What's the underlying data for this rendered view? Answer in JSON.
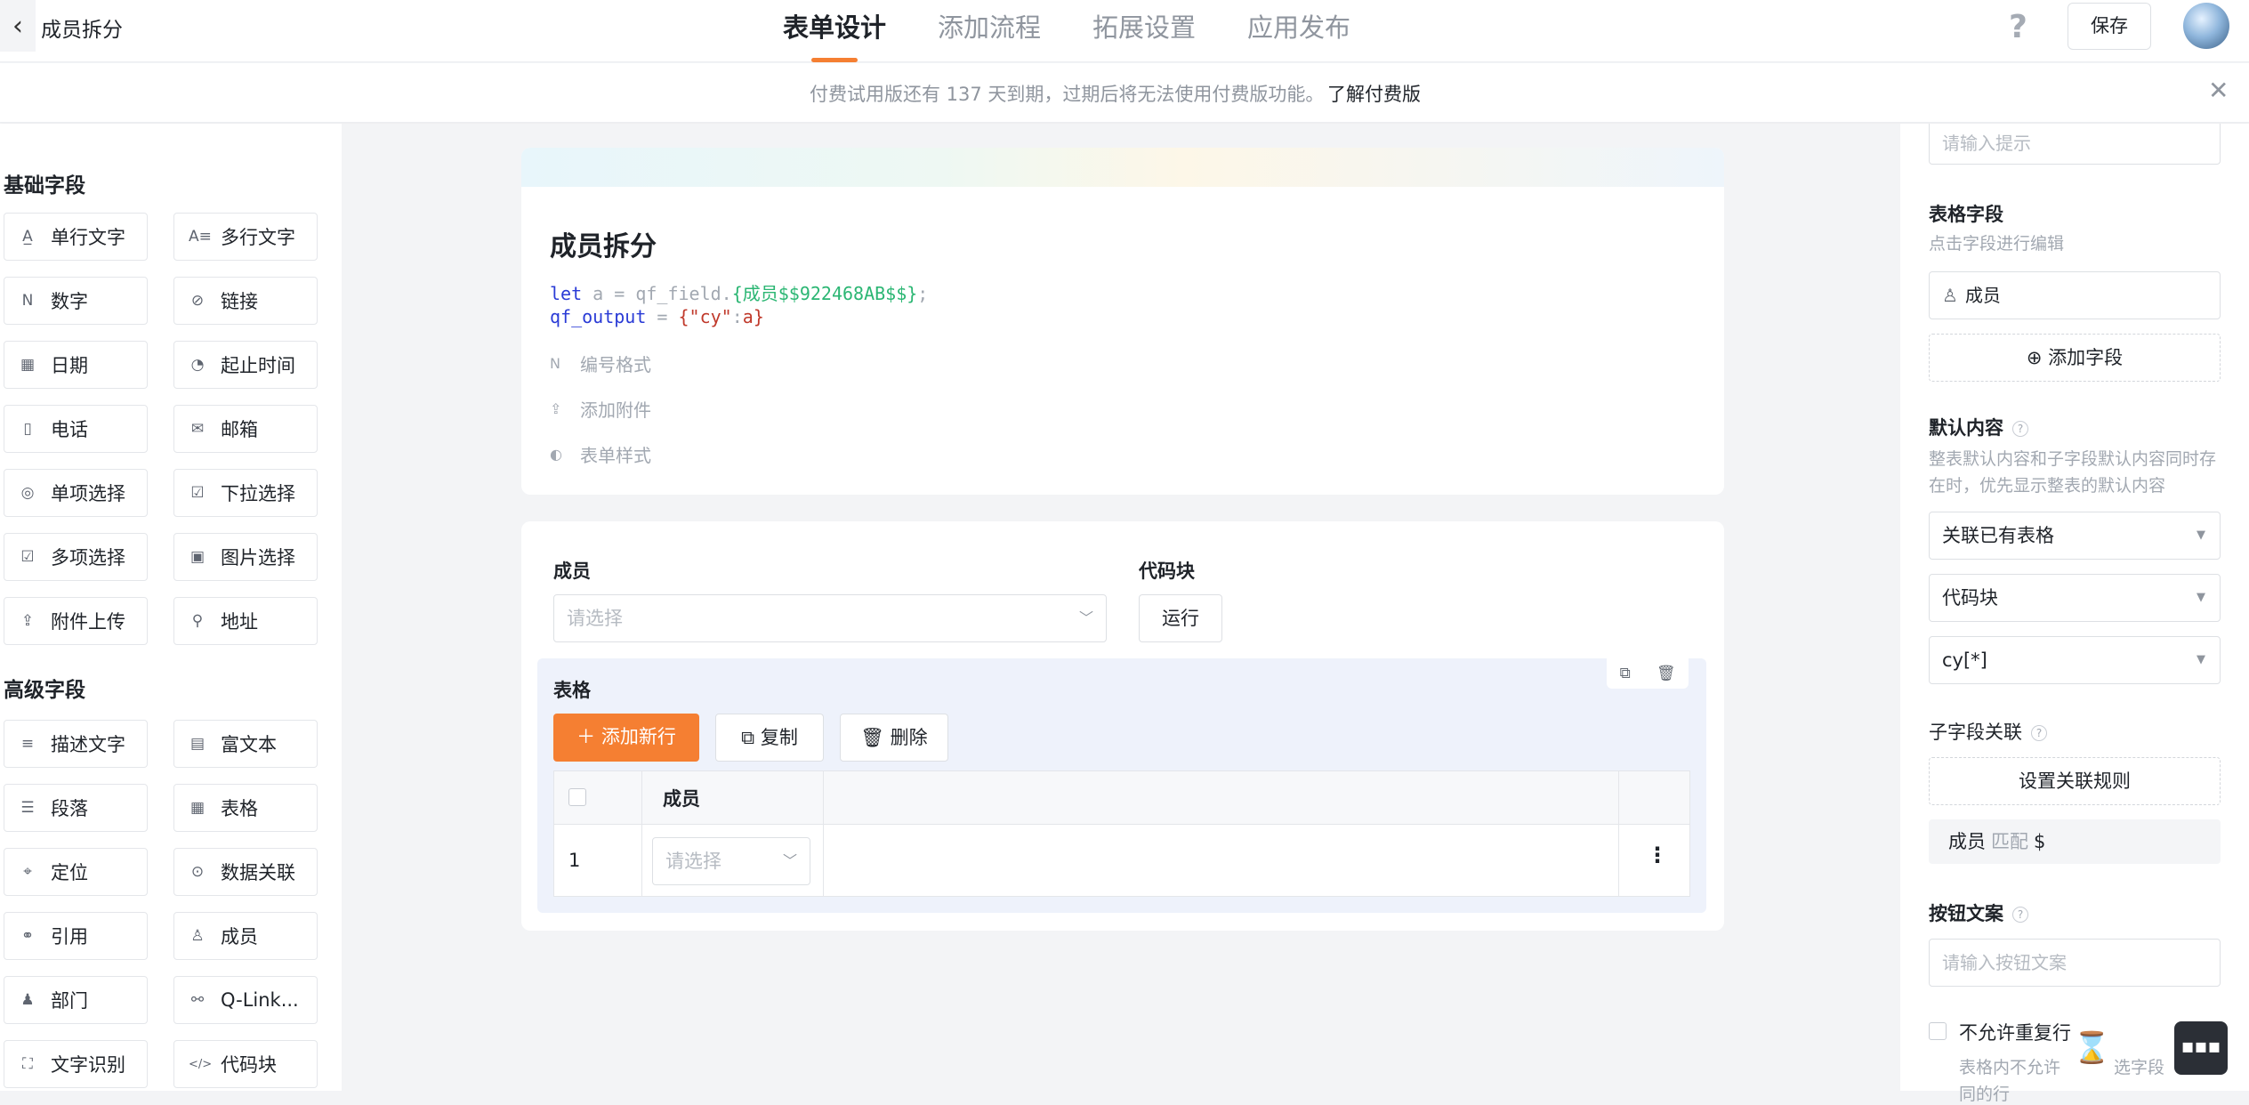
{
  "header": {
    "app_title": "成员拆分",
    "tabs": [
      "表单设计",
      "添加流程",
      "拓展设置",
      "应用发布"
    ],
    "help": "?",
    "save_label": "保存"
  },
  "banner": {
    "text": "付费试用版还有 137 天到期，过期后将无法使用付费版功能。",
    "link": "了解付费版"
  },
  "left": {
    "basic_title": "基础字段",
    "basic_fields": [
      {
        "label": "单行文字",
        "icon": "A̲"
      },
      {
        "label": "多行文字",
        "icon": "A≡"
      },
      {
        "label": "数字",
        "icon": "N"
      },
      {
        "label": "链接",
        "icon": "⊘"
      },
      {
        "label": "日期",
        "icon": "▦"
      },
      {
        "label": "起止时间",
        "icon": "◔"
      },
      {
        "label": "电话",
        "icon": "▯"
      },
      {
        "label": "邮箱",
        "icon": "✉"
      },
      {
        "label": "单项选择",
        "icon": "◎"
      },
      {
        "label": "下拉选择",
        "icon": "☑"
      },
      {
        "label": "多项选择",
        "icon": "☑"
      },
      {
        "label": "图片选择",
        "icon": "▣"
      },
      {
        "label": "附件上传",
        "icon": "⇪"
      },
      {
        "label": "地址",
        "icon": "⚲"
      }
    ],
    "advanced_title": "高级字段",
    "advanced_fields": [
      {
        "label": "描述文字",
        "icon": "≡"
      },
      {
        "label": "富文本",
        "icon": "▤"
      },
      {
        "label": "段落",
        "icon": "☰"
      },
      {
        "label": "表格",
        "icon": "▦"
      },
      {
        "label": "定位",
        "icon": "⌖"
      },
      {
        "label": "数据关联",
        "icon": "⊙"
      },
      {
        "label": "引用",
        "icon": "⚭"
      },
      {
        "label": "成员",
        "icon": "♙"
      },
      {
        "label": "部门",
        "icon": "♟"
      },
      {
        "label": "Q-Link...",
        "icon": "⚯"
      },
      {
        "label": "文字识别",
        "icon": "⛶"
      },
      {
        "label": "代码块",
        "icon": "</>"
      }
    ]
  },
  "form": {
    "title": "成员拆分",
    "code_line1": {
      "kw": "let",
      "var": " a",
      "eq": " = ",
      "obj": "qf_field.",
      "ref": "{成员$$922468AB$$}",
      "end": ";"
    },
    "code_line2": {
      "kw": "qf_output",
      "eq": " = ",
      "open": "{",
      "str": "\"cy\"",
      "colon": ":",
      "var": "a",
      "close": "}"
    },
    "options": [
      {
        "label": "编号格式",
        "icon": "N"
      },
      {
        "label": "添加附件",
        "icon": "⇪"
      },
      {
        "label": "表单样式",
        "icon": "◐"
      }
    ]
  },
  "card2": {
    "member_label": "成员",
    "member_placeholder": "请选择",
    "code_label": "代码块",
    "run_label": "运行",
    "table_label": "表格",
    "add_row": "添加新行",
    "copy": "复制",
    "delete": "删除",
    "col_member": "成员",
    "row_index": "1",
    "row_placeholder": "请选择"
  },
  "right": {
    "hint_placeholder": "请输入提示",
    "table_fields_title": "表格字段",
    "table_fields_sub": "点击字段进行编辑",
    "field_member": "成员",
    "add_field": "添加字段",
    "default_title": "默认内容",
    "default_sub": "整表默认内容和子字段默认内容同时存在时，优先显示整表的默认内容",
    "select1": "关联已有表格",
    "select2": "代码块",
    "select3": "cy[*]",
    "sub_link_title": "子字段关联",
    "set_rule": "设置关联规则",
    "rule_field": "成员",
    "rule_op": "匹配",
    "rule_value": "$",
    "btn_text_title": "按钮文案",
    "btn_text_placeholder": "请输入按钮文案",
    "no_dup_label": "不允许重复行",
    "no_dup_sub": "表格内不允许",
    "no_dup_sub2": "选字段",
    "no_dup_sub3": "同的行"
  }
}
